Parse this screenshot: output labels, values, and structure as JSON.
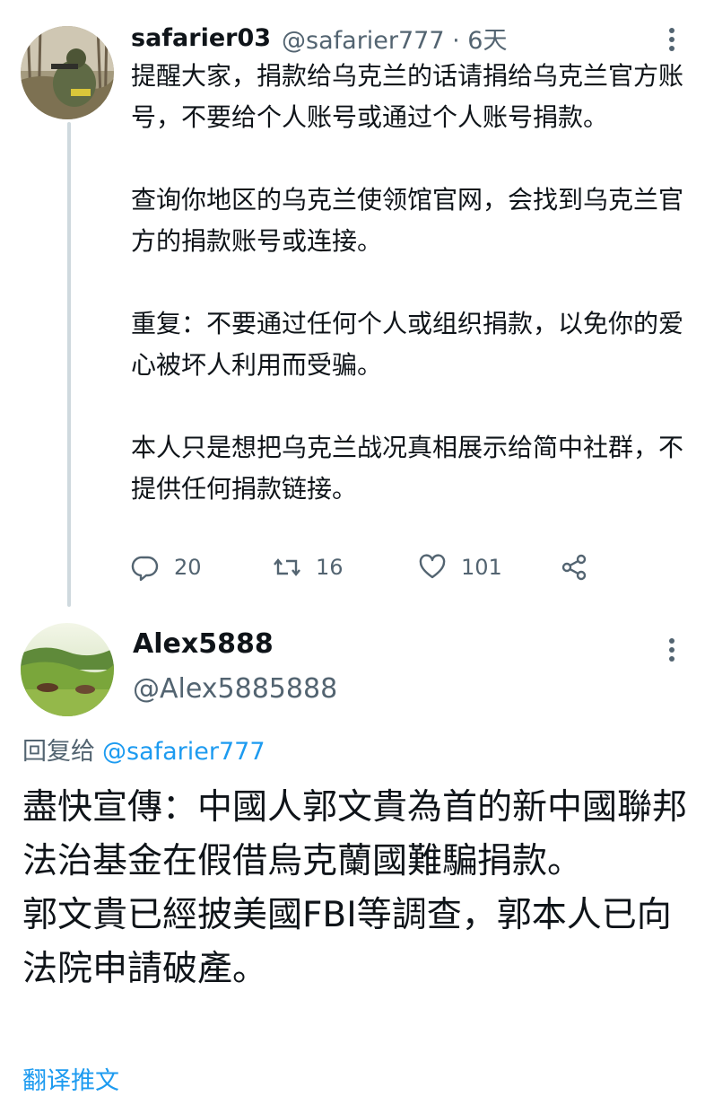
{
  "tweet": {
    "display_name": "safarier03",
    "meta": "@safarier777 · 6天",
    "paragraphs": [
      "提醒大家，捐款给乌克兰的话请捐给乌克兰官方账号，不要给个人账号或通过个人账号捐款。",
      "查询你地区的乌克兰使领馆官网，会找到乌克兰官方的捐款账号或连接。",
      "重复：不要通过任何个人或组织捐款，以免你的爱心被坏人利用而受骗。",
      "本人只是想把乌克兰战况真相展示给简中社群，不提供任何捐款链接。"
    ],
    "actions": {
      "reply_count": "20",
      "retweet_count": "16",
      "like_count": "101"
    }
  },
  "reply": {
    "display_name": "Alex5888",
    "handle": "@Alex5885888",
    "reply_prefix": "回复给",
    "reply_mention": "@safarier777",
    "lines": [
      "盡快宣傳：中國人郭文貴為首的新中國聯邦法治基金在假借烏克蘭國難騙捐款。",
      "郭文貴已經披美國FBI等調查，郭本人已向法院申請破產。"
    ],
    "translate_link": "翻译推文"
  },
  "icons": {
    "reply": "reply-icon",
    "retweet": "retweet-icon",
    "like": "heart-icon",
    "share": "share-icon",
    "more": "more-vertical-icon"
  },
  "colors": {
    "text": "#0f1419",
    "secondary": "#536471",
    "link": "#1d9bf0",
    "thread_line": "#cfd9de"
  }
}
